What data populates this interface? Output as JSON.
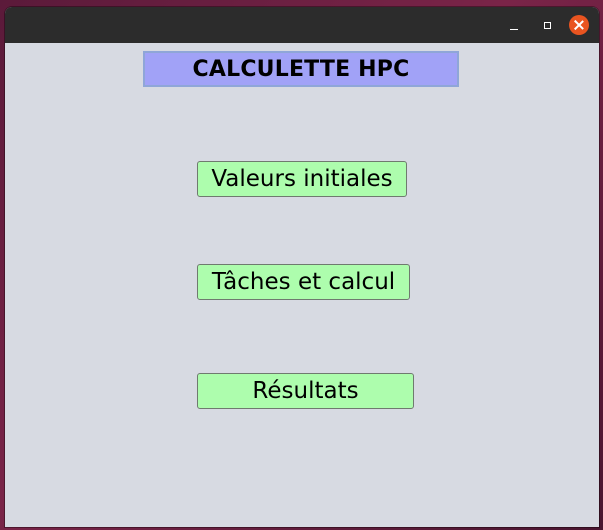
{
  "window": {
    "title_label": "CALCULETTE HPC"
  },
  "titlebar": {
    "minimize_icon": "minimize-icon",
    "maximize_icon": "maximize-icon",
    "close_icon": "close-icon",
    "close_color": "#e95420"
  },
  "buttons": {
    "initial_values": "Valeurs initiales",
    "tasks_and_calc": "Tâches et calcul",
    "results": "Résultats"
  },
  "colors": {
    "title_background": "#a1a2f7",
    "button_background": "#adfdad",
    "window_background": "#d7dae2"
  }
}
